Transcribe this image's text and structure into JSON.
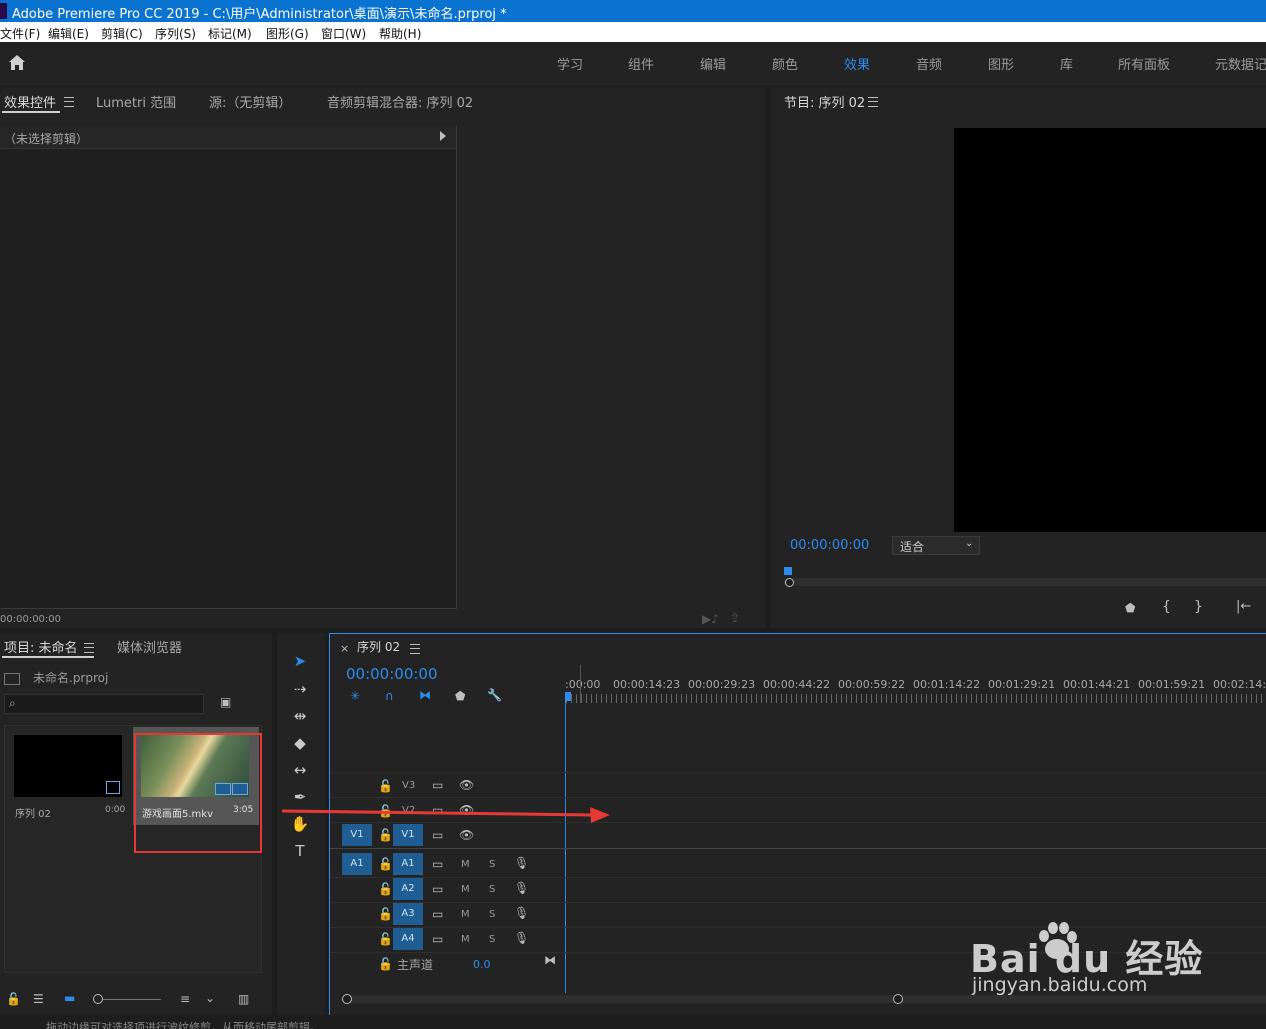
{
  "window": {
    "title": "Adobe Premiere Pro CC 2019 - C:\\用户\\Administrator\\桌面\\演示\\未命名.prproj *"
  },
  "menu": [
    "文件(F)",
    "编辑(E)",
    "剪辑(C)",
    "序列(S)",
    "标记(M)",
    "图形(G)",
    "窗口(W)",
    "帮助(H)"
  ],
  "workspaces": {
    "items": [
      "学习",
      "组件",
      "编辑",
      "颜色",
      "效果",
      "音频",
      "图形",
      "库",
      "所有面板",
      "元数据记"
    ],
    "active": "效果"
  },
  "left_top_panel": {
    "tabs": [
      "效果控件",
      "Lumetri 范围",
      "源:（无剪辑）",
      "音频剪辑混合器: 序列 02"
    ],
    "no_clip": "（未选择剪辑）",
    "timecode": "00:00:00:00"
  },
  "program_monitor": {
    "title": "节目: 序列 02",
    "timecode": "00:00:00:00",
    "fit": "适合"
  },
  "project_panel": {
    "tabs": [
      "项目: 未命名",
      "媒体浏览器"
    ],
    "file": "未命名.prproj",
    "search_placeholder": "",
    "items": [
      {
        "name": "序列 02",
        "duration": "0:00"
      },
      {
        "name": "游戏画面5.mkv",
        "duration": "3:05"
      }
    ]
  },
  "timeline": {
    "title": "序列 02",
    "timecode": "00:00:00:00",
    "ruler": [
      ":00:00",
      "00:00:14:23",
      "00:00:29:23",
      "00:00:44:22",
      "00:00:59:22",
      "00:01:14:22",
      "00:01:29:21",
      "00:01:44:21",
      "00:01:59:21",
      "00:02:14:20"
    ],
    "video_tracks": [
      "V3",
      "V2",
      "V1"
    ],
    "audio_tracks": [
      "A1",
      "A2",
      "A3",
      "A4"
    ],
    "source_v": "V1",
    "source_a": "A1",
    "master": "主声道",
    "master_value": "0.0",
    "mute": "M",
    "solo": "S"
  },
  "status_bar": "拖动边缘可对选择项进行波纹修剪，从而移动尾部剪辑。",
  "watermark": {
    "brand": "Bai du 经验",
    "url": "jingyan.baidu.com"
  },
  "colors": {
    "accent": "#2d8ceb",
    "annotation": "#e53935",
    "titlebar": "#0a73d0"
  }
}
